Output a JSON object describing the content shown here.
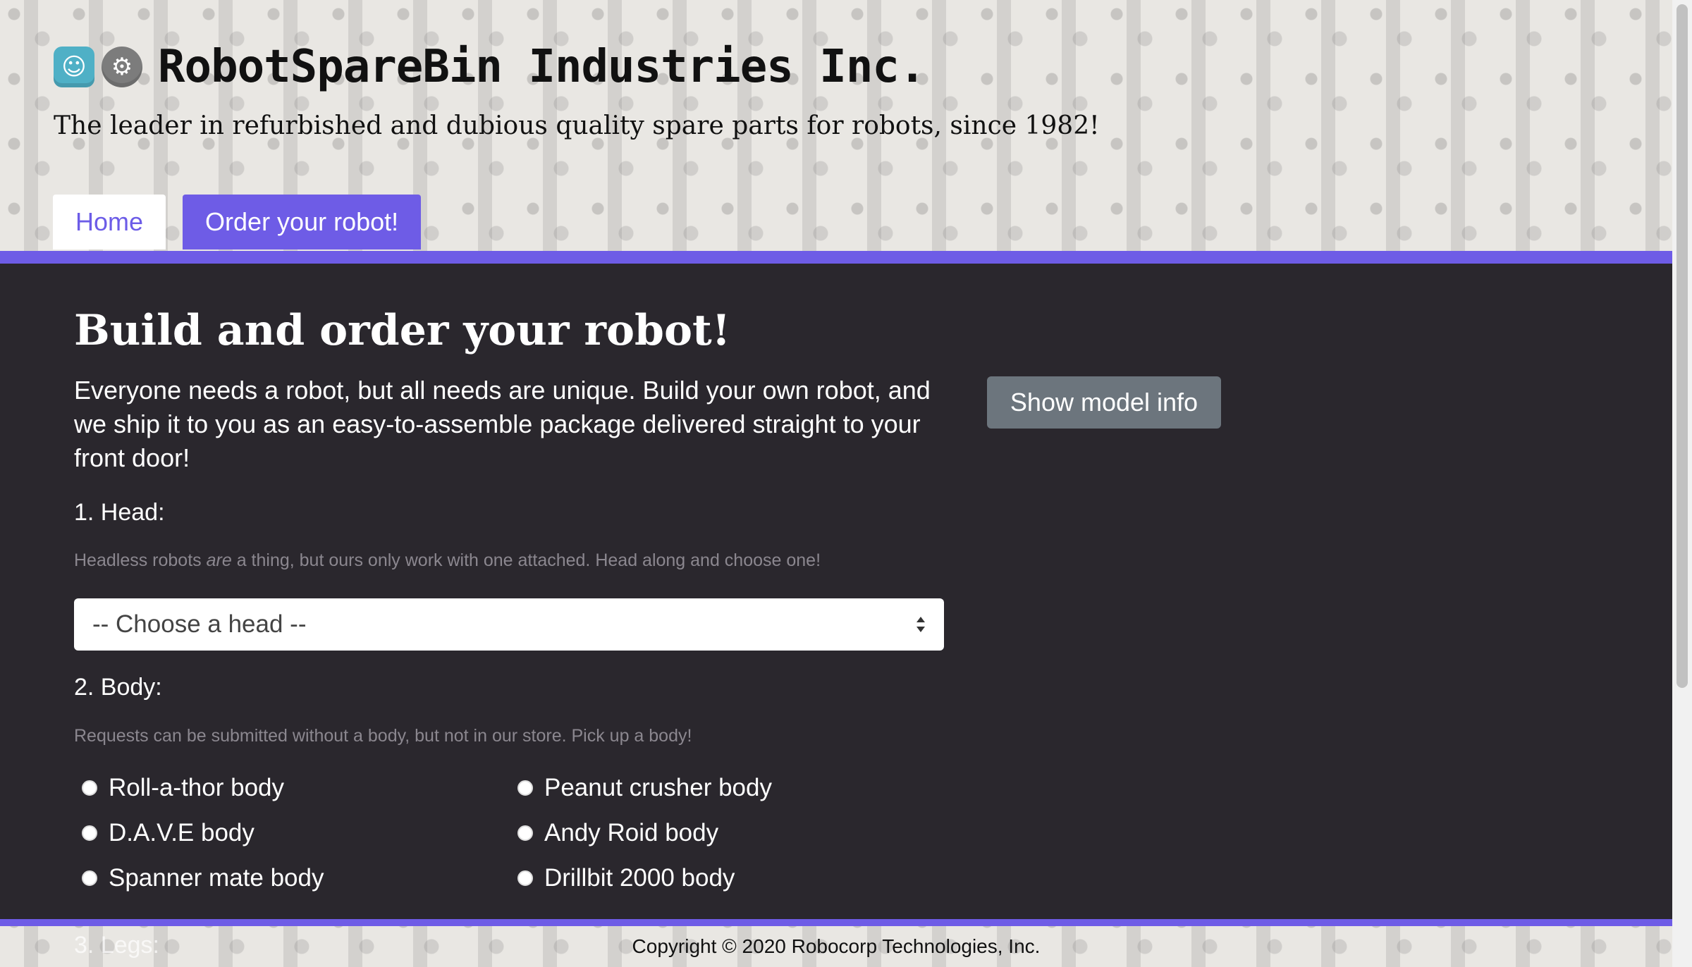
{
  "brand": {
    "title": "RobotSpareBin Industries Inc."
  },
  "header": {
    "tagline": "The leader in refurbished and dubious quality spare parts for robots, since 1982!",
    "tabs": [
      {
        "label": "Home"
      },
      {
        "label": "Order your robot!"
      }
    ]
  },
  "main": {
    "title": "Build and order your robot!",
    "intro": "Everyone needs a robot, but all needs are unique. Build your own robot, and we ship it to you as an easy-to-assemble package delivered straight to your front door!",
    "model_info_button": "Show model info",
    "head": {
      "label": "1. Head:",
      "help_pre": "Headless robots ",
      "help_em": "are",
      "help_post": " a thing, but ours only work with one attached. Head along and choose one!",
      "select_value": "-- Choose a head --"
    },
    "body": {
      "label": "2. Body:",
      "help": "Requests can be submitted without a body, but not in our store. Pick up a body!",
      "options": [
        "Roll-a-thor body",
        "Peanut crusher body",
        "D.A.V.E body",
        "Andy Roid body",
        "Spanner mate body",
        "Drillbit 2000 body"
      ]
    },
    "legs": {
      "label": "3. Legs:"
    }
  },
  "footer": {
    "copyright": "Copyright © 2020 Robocorp Technologies, Inc."
  },
  "colors": {
    "accent": "#6e5ce6",
    "main_bg": "#2a272d",
    "button_gray": "#6c757d"
  }
}
